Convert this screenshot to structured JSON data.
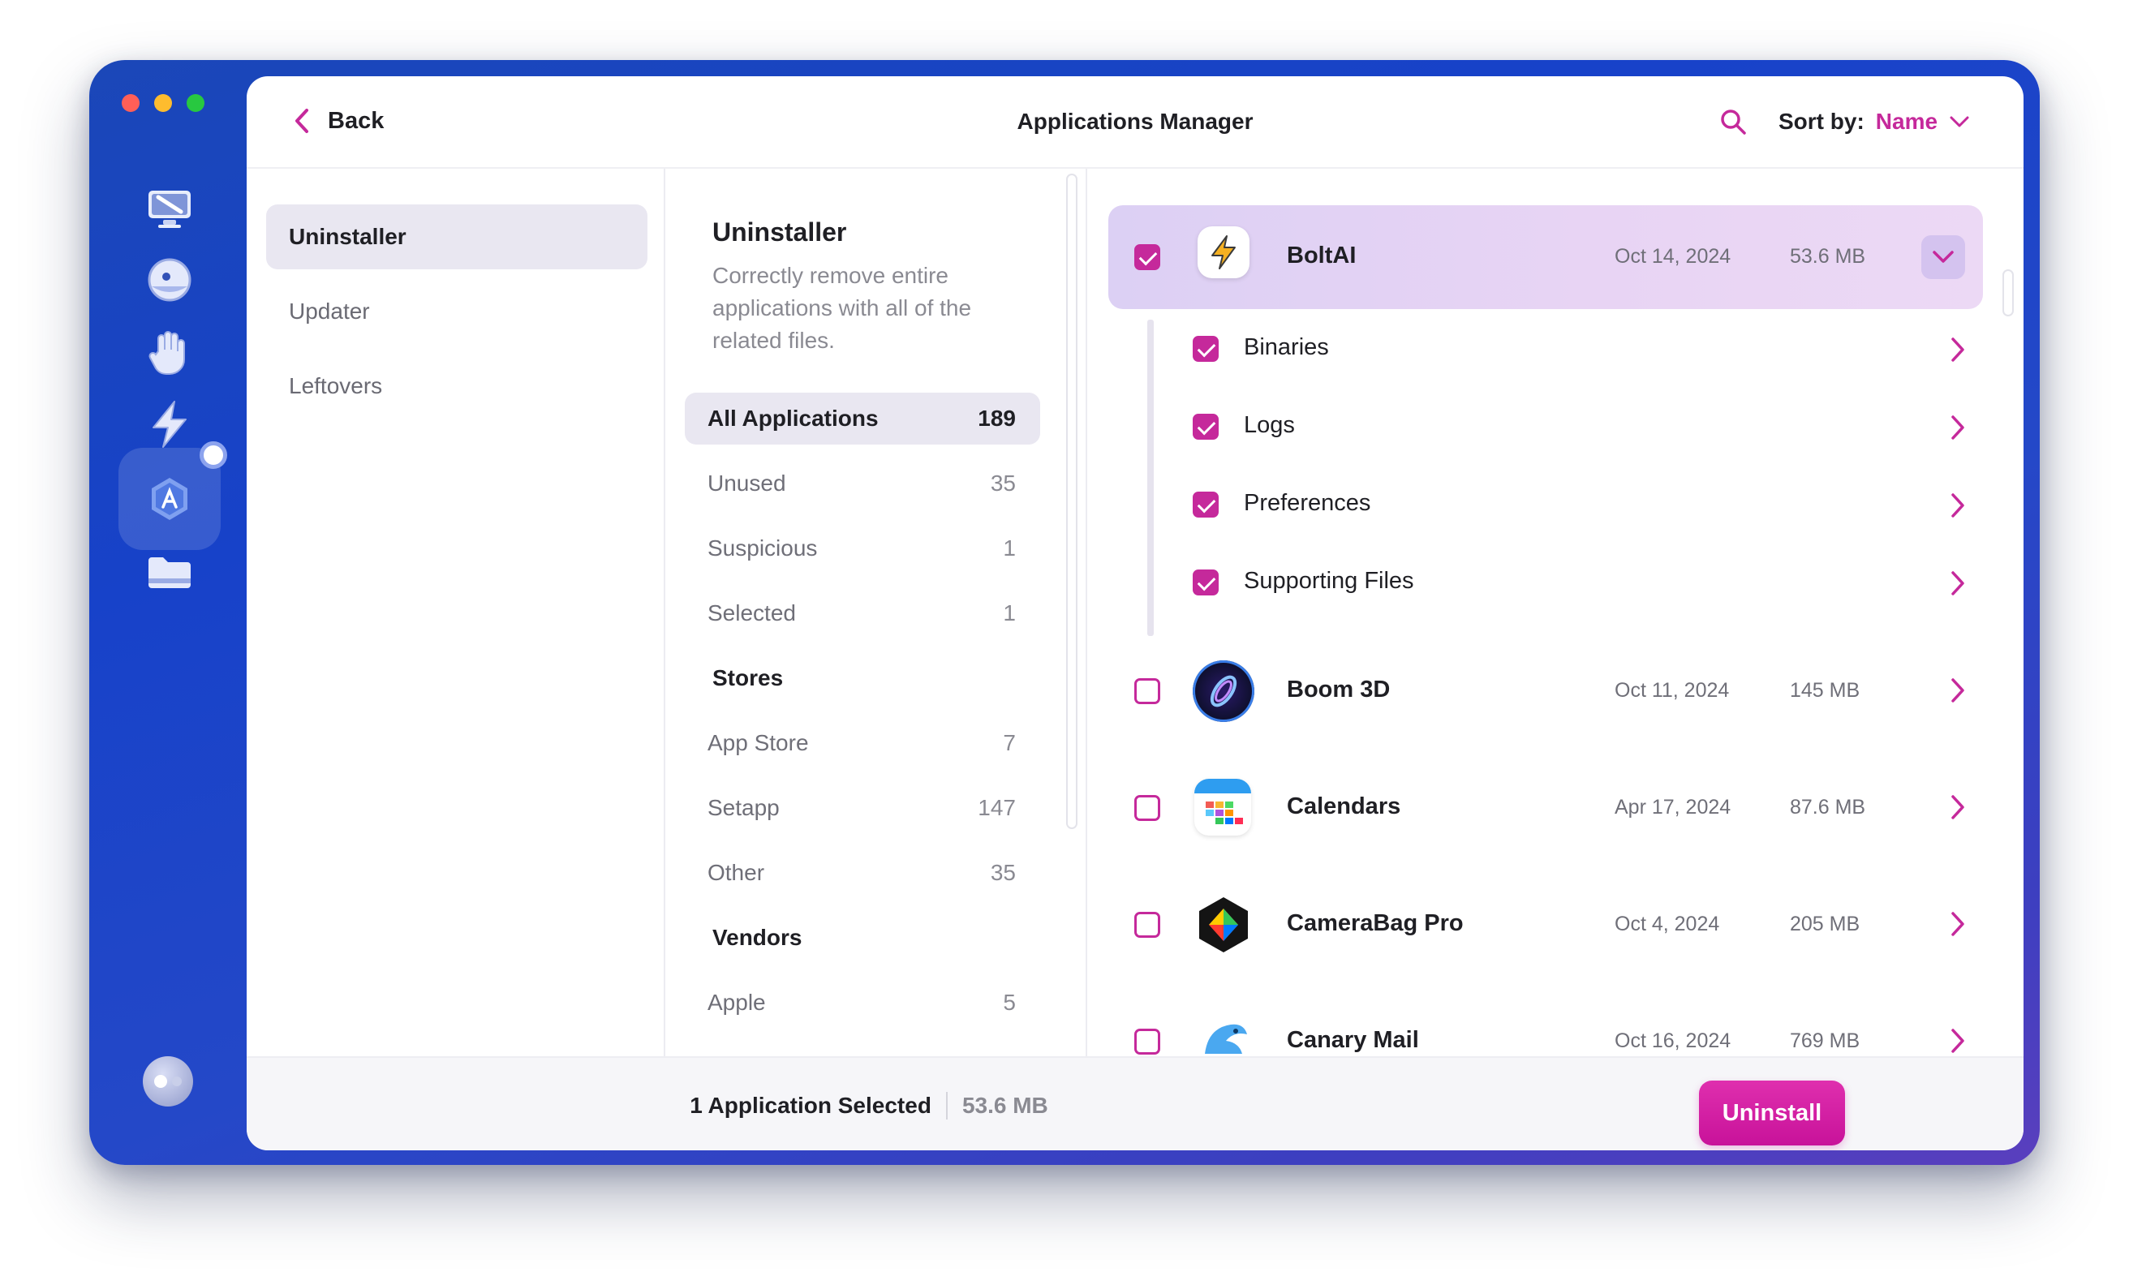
{
  "header": {
    "back_label": "Back",
    "title": "Applications Manager",
    "sort_label": "Sort by:",
    "sort_value": "Name"
  },
  "sidebar": {
    "items": [
      {
        "label": "Uninstaller",
        "active": true
      },
      {
        "label": "Updater",
        "active": false
      },
      {
        "label": "Leftovers",
        "active": false
      }
    ]
  },
  "categories": {
    "title": "Uninstaller",
    "description": "Correctly remove entire applications with all of the related files.",
    "all": {
      "label": "All Applications",
      "count": "189"
    },
    "unused": {
      "label": "Unused",
      "count": "35"
    },
    "suspicious": {
      "label": "Suspicious",
      "count": "1"
    },
    "selected": {
      "label": "Selected",
      "count": "1"
    },
    "stores_heading": "Stores",
    "app_store": {
      "label": "App Store",
      "count": "7"
    },
    "setapp": {
      "label": "Setapp",
      "count": "147"
    },
    "other": {
      "label": "Other",
      "count": "35"
    },
    "vendors_heading": "Vendors",
    "apple": {
      "label": "Apple",
      "count": "5"
    }
  },
  "apps": [
    {
      "name": "BoltAI",
      "date": "Oct 14, 2024",
      "size": "53.6 MB",
      "checked": true,
      "expanded": true,
      "icon": "bolt-icon",
      "children": [
        {
          "name": "Binaries",
          "checked": true
        },
        {
          "name": "Logs",
          "checked": true
        },
        {
          "name": "Preferences",
          "checked": true
        },
        {
          "name": "Supporting Files",
          "checked": true
        }
      ]
    },
    {
      "name": "Boom 3D",
      "date": "Oct 11, 2024",
      "size": "145 MB",
      "checked": false,
      "icon": "boom3d-icon"
    },
    {
      "name": "Calendars",
      "date": "Apr 17, 2024",
      "size": "87.6 MB",
      "checked": false,
      "icon": "calendars-icon"
    },
    {
      "name": "CameraBag Pro",
      "date": "Oct 4, 2024",
      "size": "205 MB",
      "checked": false,
      "icon": "camerabag-icon"
    },
    {
      "name": "Canary Mail",
      "date": "Oct 16, 2024",
      "size": "769 MB",
      "checked": false,
      "icon": "canary-mail-icon"
    }
  ],
  "footer": {
    "selection_count": "1 Application Selected",
    "selection_size": "53.6 MB",
    "uninstall_label": "Uninstall"
  },
  "colors": {
    "accent": "#c5299b",
    "rail_gradient_start": "#1b47b8",
    "rail_gradient_end": "#5a3fbe",
    "selected_row": "#e6d4f4"
  }
}
